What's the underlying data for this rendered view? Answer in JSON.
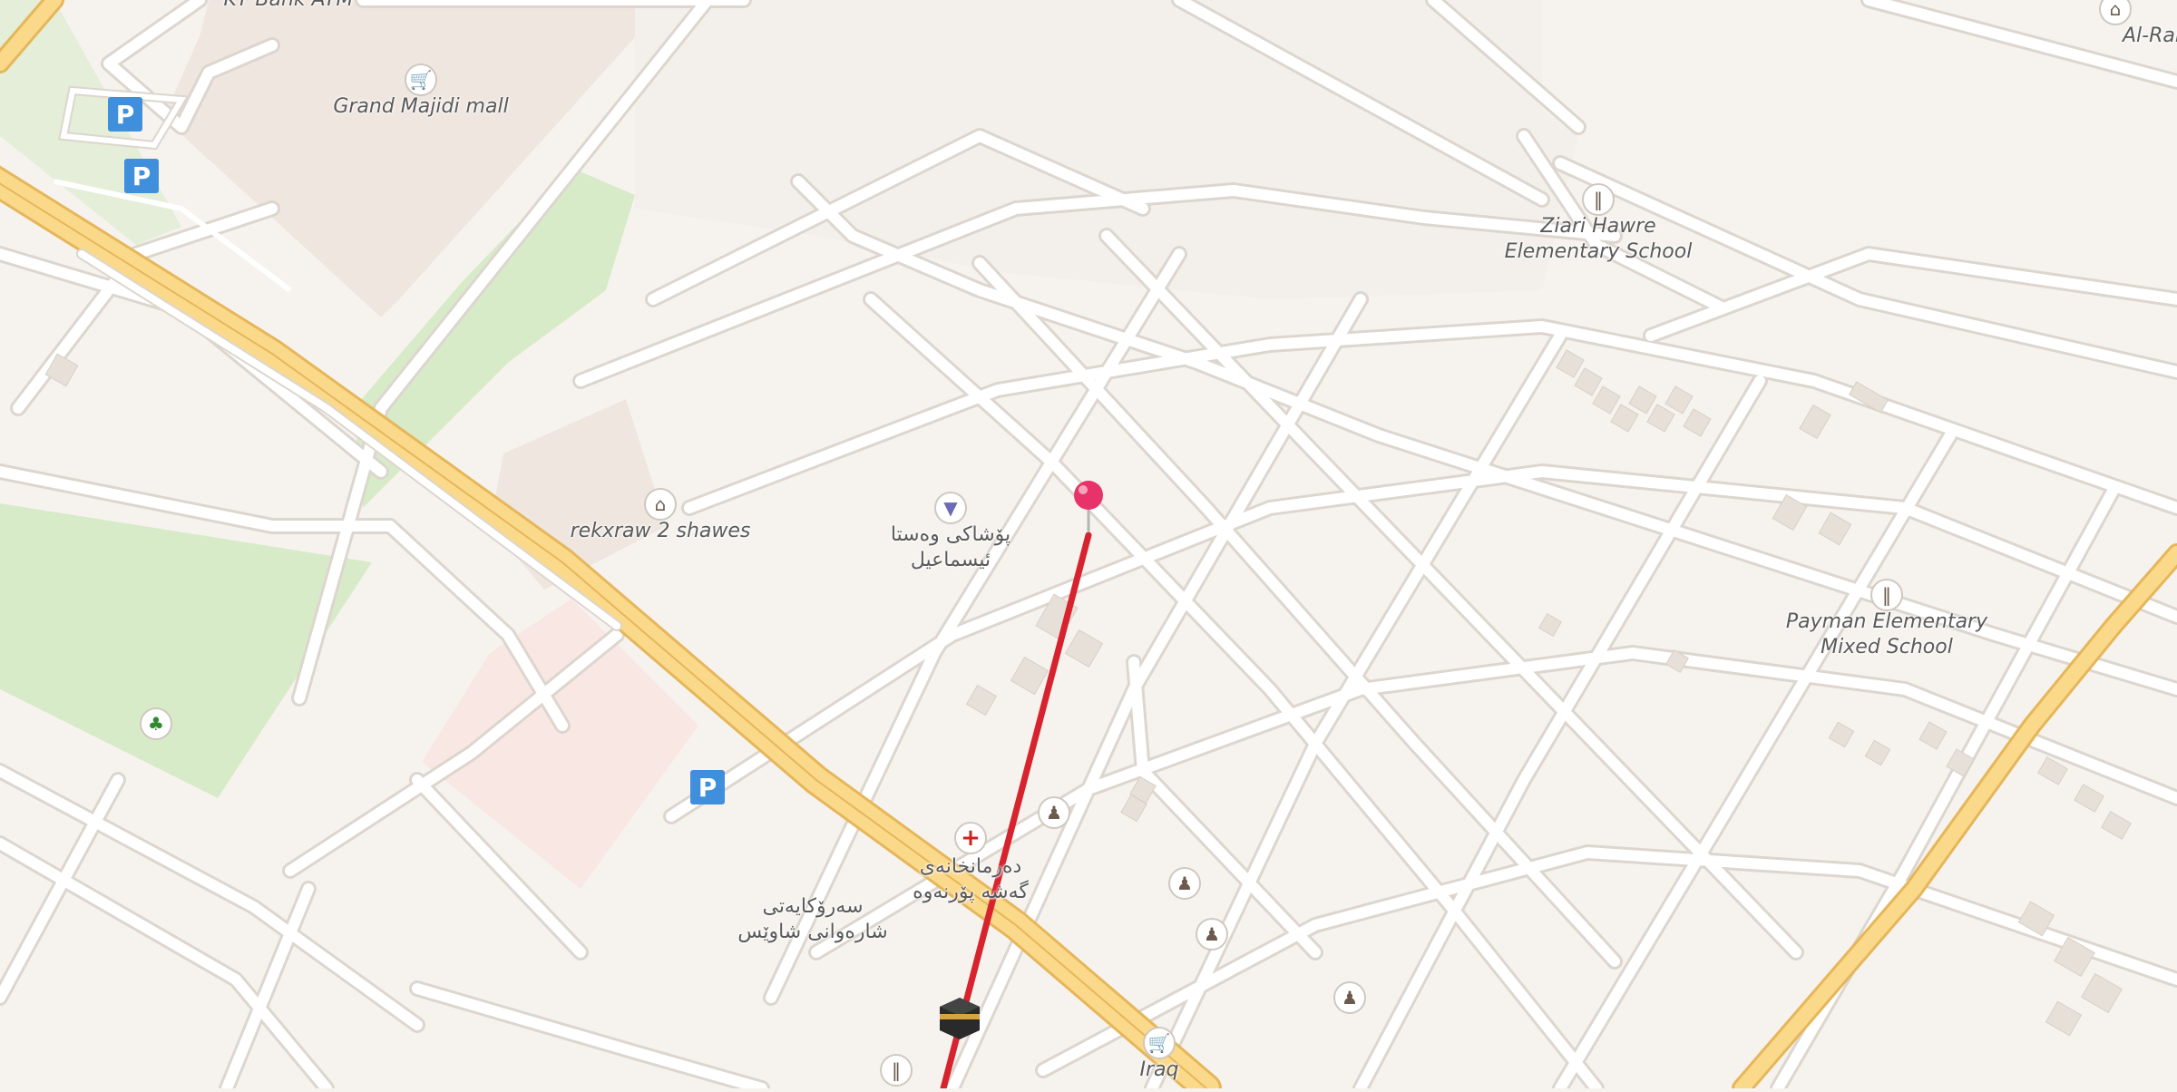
{
  "labels": {
    "grand_majidi_mall": "Grand Majidi mall",
    "kt_bank_atm": "KT Bank ATM",
    "al_rahma_mosque": "Al-Rahma Mosq",
    "ziari_hawre_line1": "Ziari Hawre",
    "ziari_hawre_line2": "Elementary School",
    "rekxraw": "rekxraw 2 shawes",
    "clothing_line1": "پۆشاکی وەستا",
    "clothing_line2": "ئیسماعیل",
    "payman_line1": "Payman Elementary",
    "payman_line2": "Mixed School",
    "hospital_line1": "دەرمانخانەی",
    "hospital_line2": "گەشە پۆرنەوە",
    "sarokayati_line1": "سەرۆکایەتی",
    "sarokayati_line2": "شارەوانی شاوێس",
    "iraq": "Iraq",
    "parking": "P"
  },
  "icons": {
    "shop": "shopping-basket-icon",
    "school": "school-icon",
    "museum": "museum-icon",
    "clothes": "clothes-shop-icon",
    "park": "tree-icon",
    "hospital": "cross-icon",
    "monument": "monument-icon",
    "mosque": "kaaba-icon",
    "pin": "map-pin-icon"
  },
  "colors": {
    "land": "#f6f3ef",
    "road": "#ffffff",
    "road_casing": "#dcd6ce",
    "primary_road": "#fbd98a",
    "primary_casing": "#e6b65a",
    "park": "#d8ebc8",
    "commercial": "#efe6df",
    "hospital_area": "#f9e7e4",
    "building": "#e6e0d8",
    "route": "#d6232e",
    "pin": "#e8336a",
    "parking": "#3f8fdc"
  }
}
